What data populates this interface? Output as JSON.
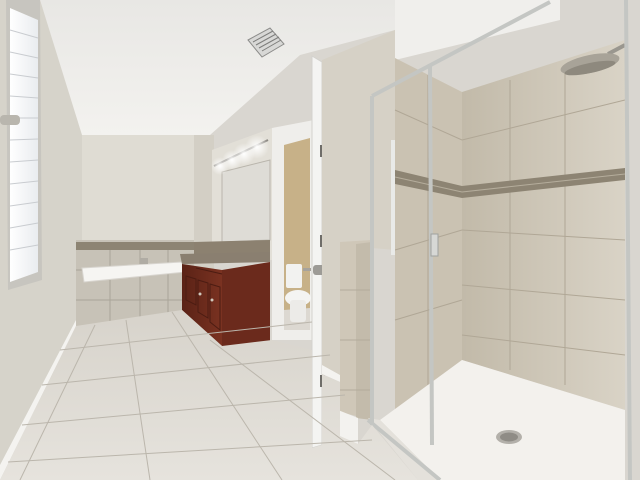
{
  "scene": {
    "kind": "photo",
    "subject": "bathroom-interior"
  },
  "colors": {
    "ceiling": "#ecebe8",
    "wall_left": "#d9d6cd",
    "wall_back": "#e0ddd4",
    "wall_right": "#d6d2c8",
    "floor_tile": "#ddd9d2",
    "floor_grout": "#bdb8af",
    "cabinet_wood": "#6b2a1c",
    "countertop": "#8a7f70",
    "tub_tile": "#c9c4b9",
    "shower_tile": "#cfc7b8",
    "mosaic_band": "#8d8473",
    "shower_pan": "#f2f0ec",
    "glass_frame": "#c8c9c6",
    "door_white": "#f4f4f2",
    "toilet_white": "#f1f1ef",
    "closet_wall": "#c9b48a"
  }
}
